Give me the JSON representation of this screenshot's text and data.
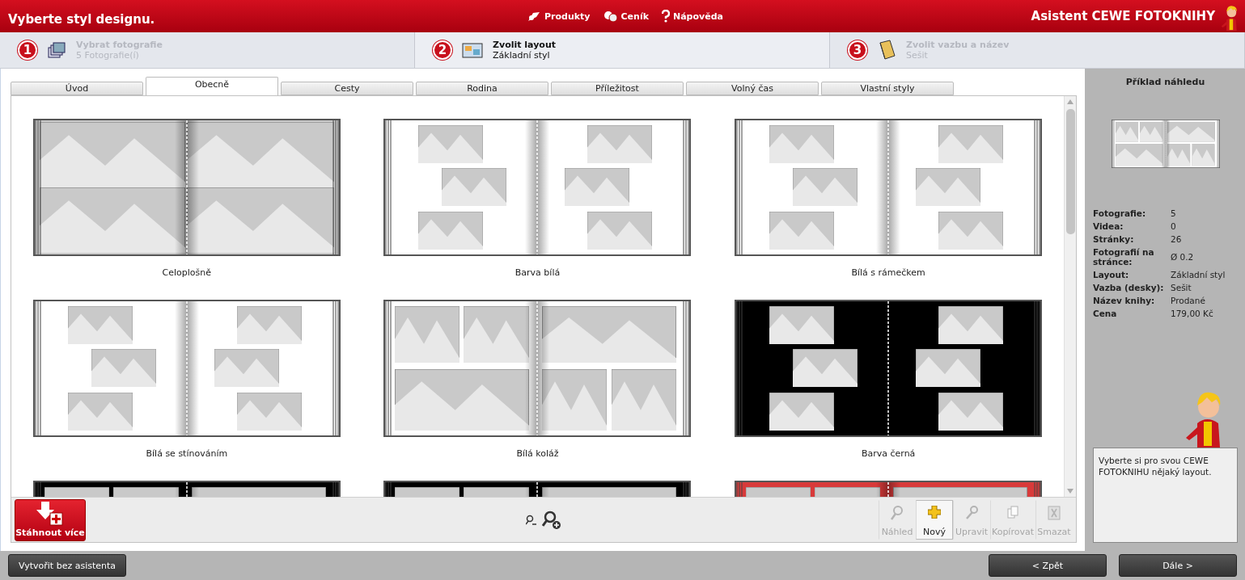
{
  "header": {
    "title": "Vyberte styl designu.",
    "nav": [
      {
        "kind": "products",
        "label": "Produkty"
      },
      {
        "kind": "prices",
        "label": "Ceník"
      },
      {
        "kind": "help",
        "label": "Nápověda"
      }
    ],
    "brand": "Asistent CEWE FOTOKNIHY"
  },
  "steps": [
    {
      "number": "1",
      "kind": "photos",
      "title": "Vybrat fotografie",
      "subtitle": "5 Fotografie(í)",
      "selected": false
    },
    {
      "number": "2",
      "kind": "layout",
      "title": "Zvolit layout",
      "subtitle": "Základní styl",
      "selected": true
    },
    {
      "number": "3",
      "kind": "binding",
      "title": "Zvolit vazbu a název",
      "subtitle": "Sešit",
      "selected": false
    }
  ],
  "tabs": [
    {
      "label": "Úvod",
      "selected": false
    },
    {
      "label": "Obecně",
      "selected": true
    },
    {
      "label": "Cesty",
      "selected": false
    },
    {
      "label": "Rodina",
      "selected": false
    },
    {
      "label": "Příležitost",
      "selected": false
    },
    {
      "label": "Volný čas",
      "selected": false
    },
    {
      "label": "Vlastní styly",
      "selected": false
    }
  ],
  "layouts": [
    {
      "kind": "full",
      "label": "Celoplošně"
    },
    {
      "kind": "white",
      "label": "Barva bílá"
    },
    {
      "kind": "frame",
      "label": "Bílá s rámečkem"
    },
    {
      "kind": "shadow",
      "label": "Bílá se stínováním"
    },
    {
      "kind": "collage",
      "label": "Bílá koláž"
    },
    {
      "kind": "black",
      "label": "Barva černá"
    },
    {
      "kind": "black-collage"
    },
    {
      "kind": "black-collage"
    },
    {
      "kind": "red-collage"
    }
  ],
  "toolbar": {
    "download": "Stáhnout více",
    "tools": [
      {
        "kind": "preview",
        "label": "Náhled",
        "disabled": true,
        "selected": false
      },
      {
        "kind": "new",
        "label": "Nový",
        "disabled": false,
        "selected": true
      },
      {
        "kind": "edit",
        "label": "Upravit",
        "disabled": true,
        "selected": false
      },
      {
        "kind": "copy",
        "label": "Kopírovat",
        "disabled": true,
        "selected": false
      },
      {
        "kind": "delete",
        "label": "Smazat",
        "disabled": true,
        "selected": false
      }
    ]
  },
  "preview": {
    "title": "Příklad náhledu",
    "details": [
      {
        "label": "Fotografie:",
        "value": "5"
      },
      {
        "label": "Videa:",
        "value": "0"
      },
      {
        "label": "Stránky:",
        "value": "26"
      },
      {
        "label": "Fotografií na stránce:",
        "value": "Ø 0.2"
      },
      {
        "label": "Layout:",
        "value": "Základní styl"
      },
      {
        "label": "Vazba (desky):",
        "value": "Sešit"
      },
      {
        "label": "Název knihy:",
        "value": "Prodané"
      },
      {
        "label": "Cena",
        "value": "179,00 Kč"
      }
    ],
    "message": "Vyberte si pro svou CEWE FOTOKNIHU nějaký layout."
  },
  "footer": {
    "skip": "Vytvořit bez asistenta",
    "back": "< Zpět",
    "next": "Dále >"
  }
}
